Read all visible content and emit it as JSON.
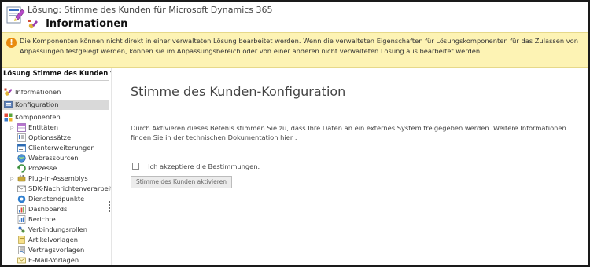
{
  "header": {
    "solution_line": "Lösung: Stimme des Kunden für Microsoft Dynamics 365",
    "title": "Informationen"
  },
  "warning": {
    "text": "Die Komponenten können nicht direkt in einer verwalteten Lösung bearbeitet werden. Wenn die verwalteten Eigenschaften für Lösungskomponenten für das Zulassen von Anpassungen festgelegt werden, können sie im Anpassungsbereich oder von einer anderen nicht verwalteten Lösung aus bearbeitet werden."
  },
  "sidebar": {
    "heading": "Lösung Stimme des Kunden für ...",
    "items": [
      {
        "label": "Informationen",
        "icon": "info-icon"
      },
      {
        "label": "Konfiguration",
        "icon": "config-icon",
        "selected": true
      },
      {
        "label": "Komponenten",
        "icon": "components-icon"
      },
      {
        "label": "Entitäten",
        "icon": "entities-icon"
      },
      {
        "label": "Optionssätze",
        "icon": "optionsets-icon"
      },
      {
        "label": "Clienterweiterungen",
        "icon": "client-extensions-icon"
      },
      {
        "label": "Webressourcen",
        "icon": "web-resources-icon"
      },
      {
        "label": "Prozesse",
        "icon": "processes-icon"
      },
      {
        "label": "Plug-In-Assemblys",
        "icon": "plugin-assemblies-icon"
      },
      {
        "label": "SDK-Nachrichtenverarbeit...",
        "icon": "sdk-message-icon"
      },
      {
        "label": "Dienstendpunkte",
        "icon": "service-endpoints-icon"
      },
      {
        "label": "Dashboards",
        "icon": "dashboards-icon"
      },
      {
        "label": "Berichte",
        "icon": "reports-icon"
      },
      {
        "label": "Verbindungsrollen",
        "icon": "connection-roles-icon"
      },
      {
        "label": "Artikelvorlagen",
        "icon": "article-templates-icon"
      },
      {
        "label": "Vertragsvorlagen",
        "icon": "contract-templates-icon"
      },
      {
        "label": "E-Mail-Vorlagen",
        "icon": "email-templates-icon"
      }
    ]
  },
  "main": {
    "title": "Stimme des Kunden-Konfiguration",
    "description_before": "Durch Aktivieren dieses Befehls stimmen Sie zu, dass Ihre Daten an ein externes System freigegeben werden. Weitere Informationen finden Sie in der technischen Dokumentation ",
    "description_link": "hier",
    "description_after": " .",
    "accept_label": "Ich akzeptiere die Bestimmungen.",
    "accept_checked": false,
    "activate_button": "Stimme des Kunden aktivieren"
  },
  "colors": {
    "warning_background": "#fdf3b4",
    "warning_icon": "#e98b0f",
    "selection_background": "#d9d9d9"
  }
}
